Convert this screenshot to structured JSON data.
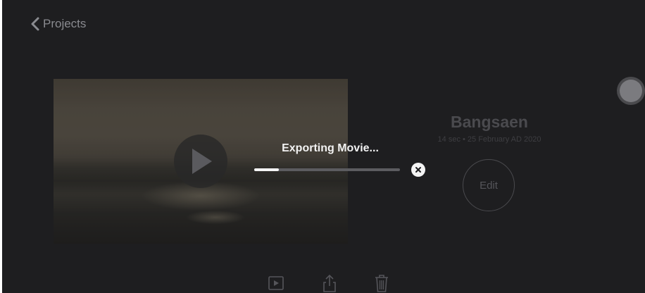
{
  "nav": {
    "back_label": "Projects",
    "back_icon": "chevron-left-icon"
  },
  "project": {
    "title": "Bangsaen",
    "meta": "14 sec • 25 February AD 2020",
    "edit_label": "Edit"
  },
  "export": {
    "label": "Exporting Movie...",
    "progress_fraction": 0.17
  },
  "toolbar": {
    "icons": [
      "play-movie-icon",
      "share-icon",
      "trash-icon"
    ]
  },
  "colors": {
    "background": "#1e1e20",
    "accent_white": "#f4f4f4",
    "muted_text": "#4a4a4e"
  }
}
